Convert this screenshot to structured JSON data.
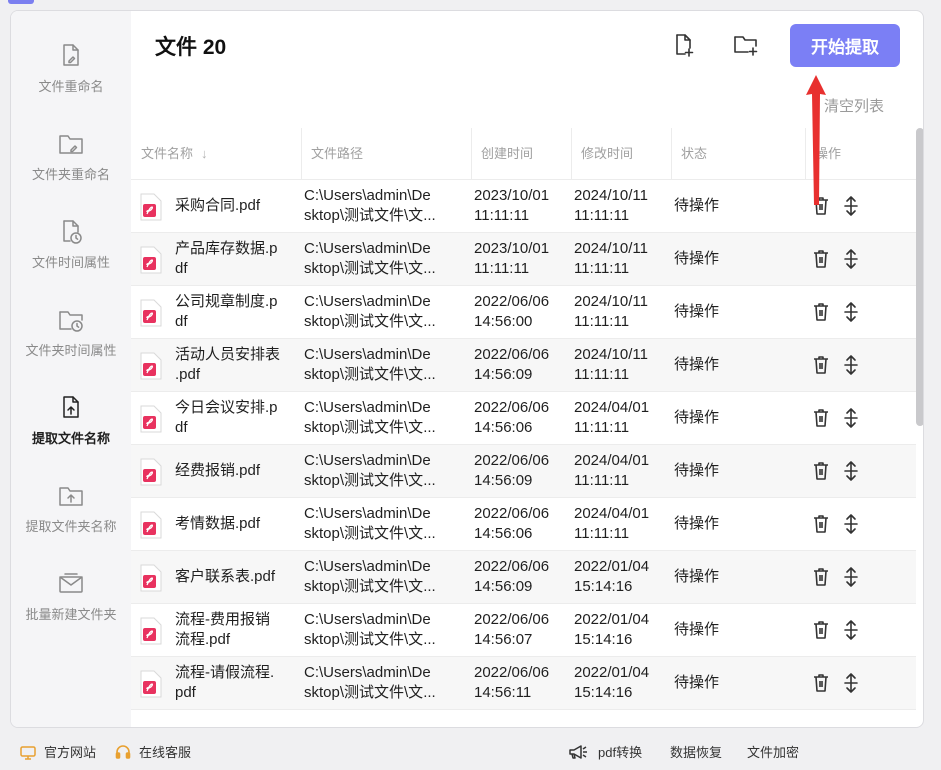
{
  "sidebar": {
    "items": [
      {
        "label": "文件重命名",
        "icon": "file-edit-icon",
        "active": false
      },
      {
        "label": "文件夹重命名",
        "icon": "folder-edit-icon",
        "active": false
      },
      {
        "label": "文件时间属性",
        "icon": "file-clock-icon",
        "active": false
      },
      {
        "label": "文件夹时间属性",
        "icon": "folder-clock-icon",
        "active": false
      },
      {
        "label": "提取文件名称",
        "icon": "file-upload-icon",
        "active": true
      },
      {
        "label": "提取文件夹名称",
        "icon": "folder-upload-icon",
        "active": false
      },
      {
        "label": "批量新建文件夹",
        "icon": "folder-new-icon",
        "active": false
      }
    ]
  },
  "header": {
    "title": "文件 20",
    "add_file_icon": "file-plus-icon",
    "add_folder_icon": "folder-plus-icon",
    "start_label": "开始提取",
    "clear_label": "清空列表",
    "accent_color": "#7b7ff5"
  },
  "table": {
    "columns": [
      "文件名称",
      "文件路径",
      "创建时间",
      "修改时间",
      "状态",
      "操作"
    ],
    "sort_icon": "arrow-down-icon",
    "rows": [
      {
        "name": [
          "采购合同.pdf"
        ],
        "path": [
          "C:\\Users\\admin\\De",
          "sktop\\测试文件\\文..."
        ],
        "created": [
          "2023/10/01",
          "11:11:11"
        ],
        "modified": [
          "2024/10/11",
          "11:11:11"
        ],
        "status": "待操作"
      },
      {
        "name": [
          "产品库存数据.p",
          "df"
        ],
        "path": [
          "C:\\Users\\admin\\De",
          "sktop\\测试文件\\文..."
        ],
        "created": [
          "2023/10/01",
          "11:11:11"
        ],
        "modified": [
          "2024/10/11",
          "11:11:11"
        ],
        "status": "待操作"
      },
      {
        "name": [
          "公司规章制度.p",
          "df"
        ],
        "path": [
          "C:\\Users\\admin\\De",
          "sktop\\测试文件\\文..."
        ],
        "created": [
          "2022/06/06",
          "14:56:00"
        ],
        "modified": [
          "2024/10/11",
          "11:11:11"
        ],
        "status": "待操作"
      },
      {
        "name": [
          "活动人员安排表",
          ".pdf"
        ],
        "path": [
          "C:\\Users\\admin\\De",
          "sktop\\测试文件\\文..."
        ],
        "created": [
          "2022/06/06",
          "14:56:09"
        ],
        "modified": [
          "2024/10/11",
          "11:11:11"
        ],
        "status": "待操作"
      },
      {
        "name": [
          "今日会议安排.p",
          "df"
        ],
        "path": [
          "C:\\Users\\admin\\De",
          "sktop\\测试文件\\文..."
        ],
        "created": [
          "2022/06/06",
          "14:56:06"
        ],
        "modified": [
          "2024/04/01",
          "11:11:11"
        ],
        "status": "待操作"
      },
      {
        "name": [
          "经费报销.pdf"
        ],
        "path": [
          "C:\\Users\\admin\\De",
          "sktop\\测试文件\\文..."
        ],
        "created": [
          "2022/06/06",
          "14:56:09"
        ],
        "modified": [
          "2024/04/01",
          "11:11:11"
        ],
        "status": "待操作"
      },
      {
        "name": [
          "考情数据.pdf"
        ],
        "path": [
          "C:\\Users\\admin\\De",
          "sktop\\测试文件\\文..."
        ],
        "created": [
          "2022/06/06",
          "14:56:06"
        ],
        "modified": [
          "2024/04/01",
          "11:11:11"
        ],
        "status": "待操作"
      },
      {
        "name": [
          "客户联系表.pdf"
        ],
        "path": [
          "C:\\Users\\admin\\De",
          "sktop\\测试文件\\文..."
        ],
        "created": [
          "2022/06/06",
          "14:56:09"
        ],
        "modified": [
          "2022/01/04",
          "15:14:16"
        ],
        "status": "待操作"
      },
      {
        "name": [
          "流程-费用报销",
          "流程.pdf"
        ],
        "path": [
          "C:\\Users\\admin\\De",
          "sktop\\测试文件\\文..."
        ],
        "created": [
          "2022/06/06",
          "14:56:07"
        ],
        "modified": [
          "2022/01/04",
          "15:14:16"
        ],
        "status": "待操作"
      },
      {
        "name": [
          "流程-请假流程.",
          "pdf"
        ],
        "path": [
          "C:\\Users\\admin\\De",
          "sktop\\测试文件\\文..."
        ],
        "created": [
          "2022/06/06",
          "14:56:11"
        ],
        "modified": [
          "2022/01/04",
          "15:14:16"
        ],
        "status": "待操作"
      }
    ],
    "delete_icon": "trash-icon",
    "move_icon": "move-vertical-icon",
    "pdf_icon": "pdf-file-icon",
    "pdf_color": "#e8325f"
  },
  "footer": {
    "website_label": "官方网站",
    "service_label": "在线客服",
    "pdf_label": "pdf转换",
    "recovery_label": "数据恢复",
    "encrypt_label": "文件加密"
  }
}
